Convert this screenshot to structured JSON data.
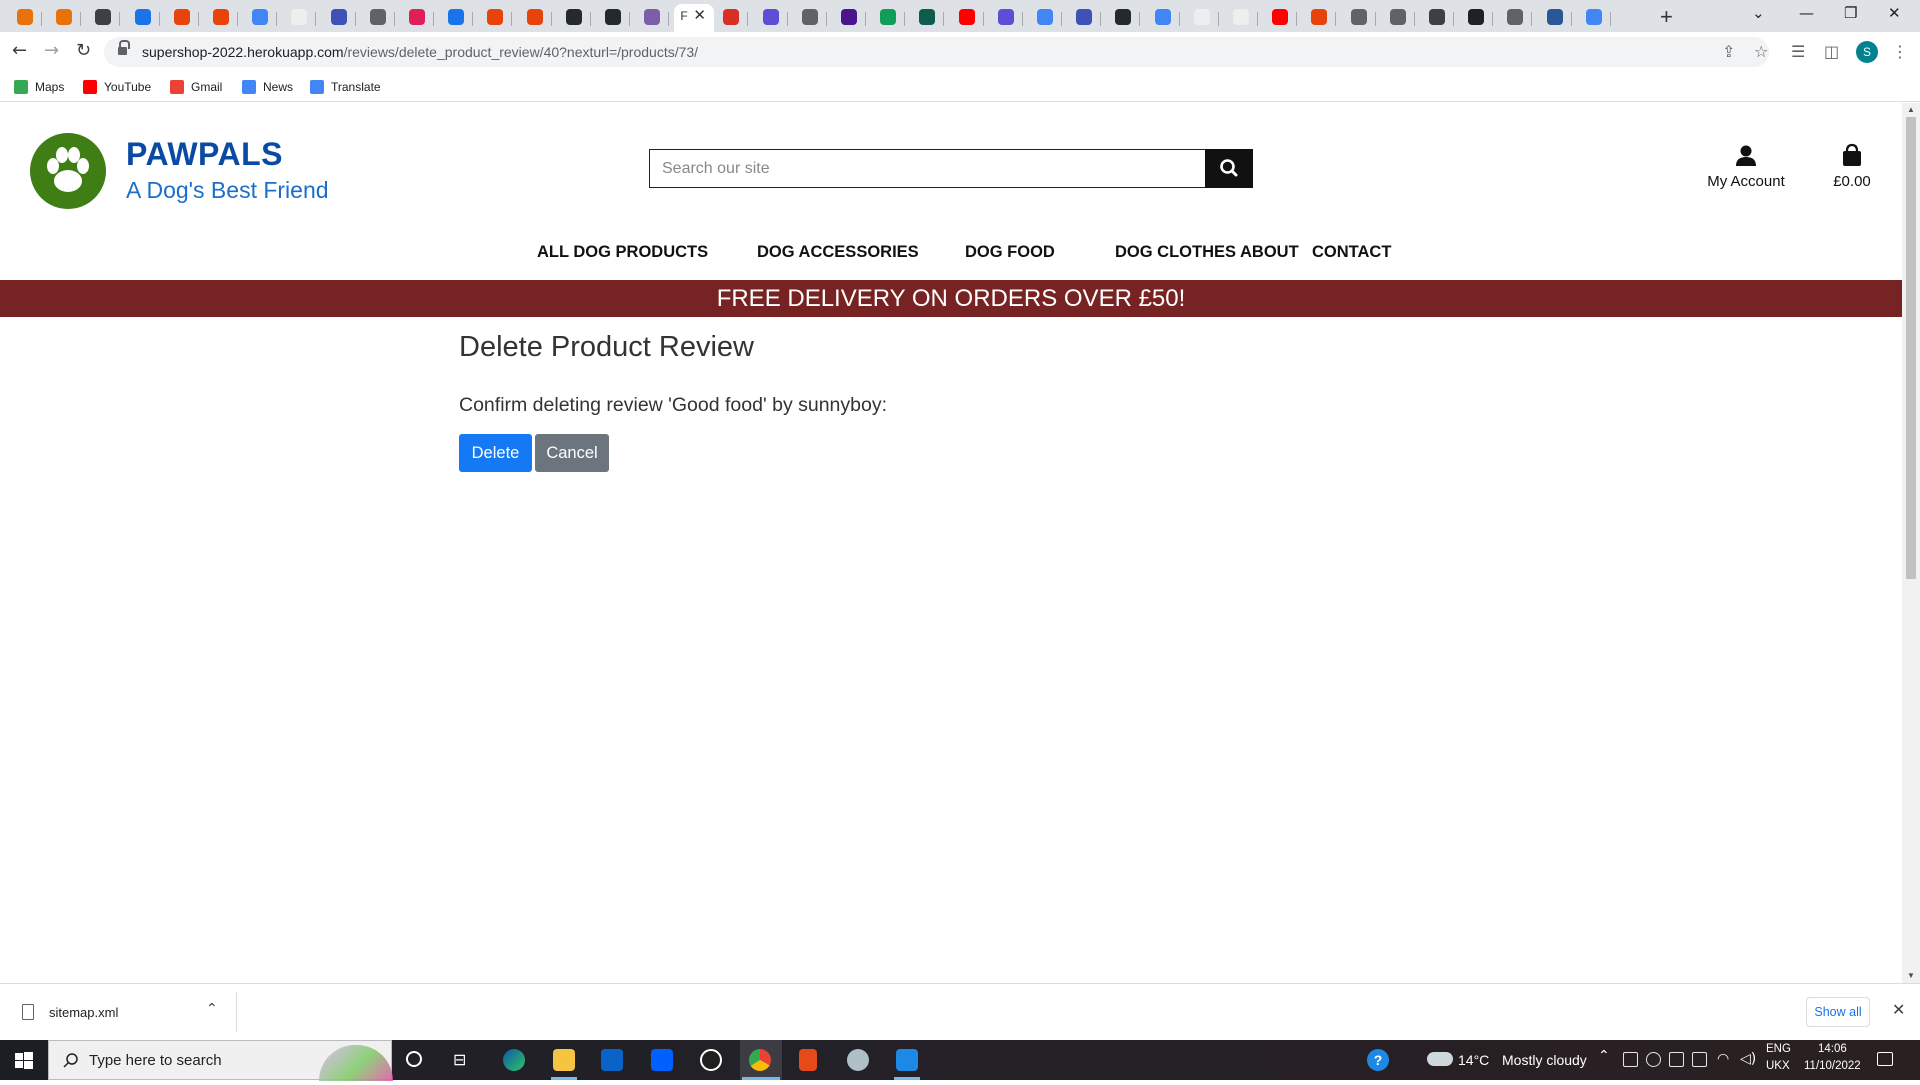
{
  "browser": {
    "active_tab_label": "F",
    "url_host": "supershop-2022.herokuapp.com",
    "url_path": "/reviews/delete_product_review/40?nexturl=/products/73/",
    "profile_initial": "S",
    "tab_favicon_colors": [
      "#e8710a",
      "#e8710a",
      "#3c4043",
      "#1a73e8",
      "#e8430a",
      "#e8430a",
      "#4285f4",
      "#eeeeee",
      "#3f51b5",
      "#5f6368",
      "#e01e5a",
      "#1a73e8",
      "#e8430a",
      "#e8430a",
      "#24292f",
      "#24292f",
      "#7b5ea7",
      "#1a73e8",
      "#d93025",
      "#5d4ed6",
      "#5f6368",
      "#4a148c",
      "#0f9d58",
      "#0f5c4f",
      "#ff0000",
      "#5d4ed6",
      "#4285f4",
      "#3f51b5",
      "#24292f",
      "#4285f4",
      "#eeeeee",
      "#eeeeee",
      "#ff0000",
      "#e8430a",
      "#5f6368",
      "#5f6368",
      "#3c4043",
      "#202124",
      "#5f6368",
      "#2b5797",
      "#4285f4"
    ]
  },
  "bookmarks": [
    {
      "label": "Maps",
      "icon": "maps-icon",
      "color": "#34a853"
    },
    {
      "label": "YouTube",
      "icon": "youtube-icon",
      "color": "#ff0000"
    },
    {
      "label": "Gmail",
      "icon": "gmail-icon",
      "color": "#ea4335"
    },
    {
      "label": "News",
      "icon": "news-icon",
      "color": "#4285f4"
    },
    {
      "label": "Translate",
      "icon": "translate-icon",
      "color": "#4285f4"
    }
  ],
  "site": {
    "brand": "PAWPALS",
    "tagline": "A Dog's Best Friend",
    "search_placeholder": "Search our site",
    "account_label": "My Account",
    "bag_total": "£0.00",
    "nav": [
      "ALL DOG PRODUCTS",
      "DOG ACCESSORIES",
      "DOG FOOD",
      "DOG CLOTHES",
      "ABOUT",
      "CONTACT"
    ],
    "banner": "FREE DELIVERY ON ORDERS OVER £50!",
    "colors": {
      "brand_blue": "#0b4aa2",
      "logo_green": "#3f7d15",
      "banner": "#782323",
      "delete_btn": "#1579f5",
      "cancel_btn": "#6c757d"
    }
  },
  "main": {
    "title": "Delete Product Review",
    "confirm_text": "Confirm deleting review 'Good food' by sunnyboy:",
    "delete_label": "Delete",
    "cancel_label": "Cancel"
  },
  "downloads": {
    "file_name": "sitemap.xml",
    "show_all": "Show all"
  },
  "taskbar": {
    "search_placeholder": "Type here to search",
    "temperature": "14°C",
    "weather": "Mostly cloudy",
    "language": "ENG",
    "layout": "UKX",
    "time": "14:06",
    "date": "11/10/2022"
  }
}
